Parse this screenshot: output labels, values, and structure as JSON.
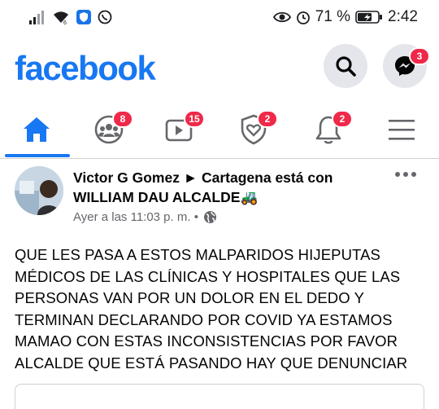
{
  "status_bar": {
    "battery_percent": "71 %",
    "time": "2:42",
    "battery_level": 0.71,
    "icons": [
      "signal-icon",
      "wifi-icon",
      "shield-app-icon",
      "whatsapp-icon",
      "eye-icon",
      "alarm-icon",
      "battery-icon"
    ]
  },
  "header": {
    "logo": "facebook",
    "messenger_badge": "3"
  },
  "tabs": [
    {
      "name": "home",
      "badge": "",
      "active": true
    },
    {
      "name": "groups",
      "badge": "8"
    },
    {
      "name": "watch",
      "badge": "15"
    },
    {
      "name": "dating",
      "badge": "2"
    },
    {
      "name": "notifications",
      "badge": "2"
    },
    {
      "name": "menu",
      "badge": ""
    }
  ],
  "post": {
    "author_line_1": "Victor G Gomez ► Cartagena está con",
    "author_line_2": "WILLIAM DAU ALCALDE",
    "emoji": "🚜",
    "timestamp": "Ayer a las 11:03 p. m. •",
    "text": "QUE LES PASA A ESTOS MALPARIDOS HIJEPUTAS MÉDICOS DE LAS CLÍNICAS Y HOSPITALES QUE LAS PERSONAS VAN POR UN DOLOR EN EL DEDO Y TERMINAN DECLARANDO POR COVID YA ESTAMOS MAMAO CON ESTAS INCONSISTENCIAS POR FAVOR ALCALDE QUE ESTÁ PASANDO HAY QUE DENUNCIAR"
  },
  "colors": {
    "brand": "#1877f2",
    "badge": "#f02849",
    "icon_gray": "#65676b"
  }
}
